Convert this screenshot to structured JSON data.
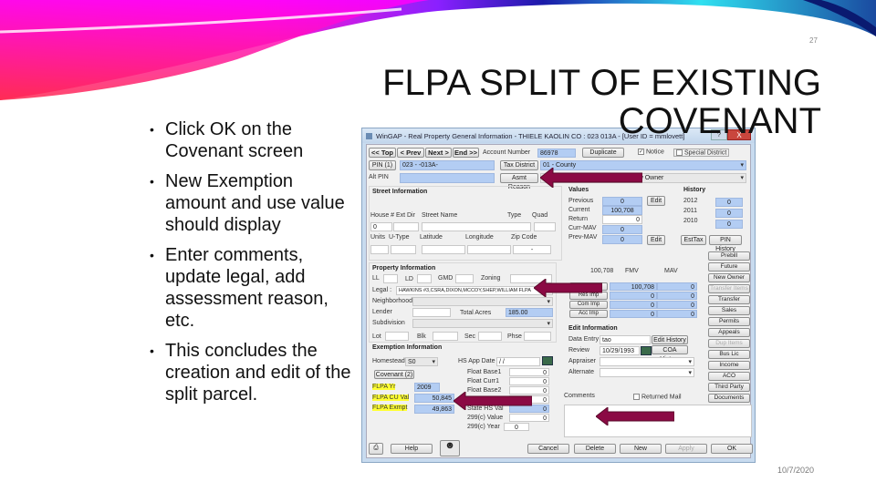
{
  "slide": {
    "number": "27",
    "title": "FLPA SPLIT OF EXISTING COVENANT",
    "date": "10/7/2020",
    "bullets": [
      "Click OK on the Covenant screen",
      "New Exemption amount and use value should display",
      "Enter comments, update legal, add assessment reason, etc.",
      "This concludes the creation and edit of the split parcel."
    ]
  },
  "window": {
    "title": "WinGAP - Real Property General Information - THIELE KAOLIN CO : 023    013A      - [User ID = mmlovett]",
    "help_btn": "?",
    "close_btn": "X",
    "nav": {
      "top": "<< Top",
      "prev": "< Prev",
      "next": "Next >",
      "end": "End >>"
    },
    "account_number_label": "Account Number",
    "account_number": "86978",
    "duplicate": "Duplicate",
    "notice_label": "Notice",
    "notice_checked": true,
    "special_district_label": "Special District",
    "pin_btn": "PIN (1)",
    "pin_value": "023 -  -013A-",
    "tax_district_btn": "Tax District",
    "tax_district_value": "01 - County",
    "alt_pin_label": "Alt PIN",
    "asmt_reason_btn": "Asmt Reason",
    "asmt_reason_value": "to New Owner",
    "street": {
      "heading": "Street Information",
      "labels": [
        "House #",
        "Ext",
        "Dir",
        "Street Name",
        "Type",
        "Quad"
      ],
      "house_no": "0",
      "labels2": [
        "Units",
        "U-Type",
        "Latitude",
        "Longitude",
        "Zip Code"
      ],
      "zip": "-"
    },
    "values": {
      "heading": "Values",
      "previous_label": "Previous",
      "previous": "0",
      "current_label": "Current",
      "current": "100,708",
      "return_label": "Return",
      "return": "0",
      "curr_mav_label": "Curr-MAV",
      "curr_mav": "0",
      "prev_mav_label": "Prev-MAV",
      "prev_mav": "0",
      "edit": "Edit"
    },
    "history": {
      "heading": "History",
      "rows": [
        {
          "year": "2012",
          "value": "0"
        },
        {
          "year": "2011",
          "value": "0"
        },
        {
          "year": "2010",
          "value": "0"
        }
      ],
      "est_tax": "EstTax",
      "pin_history": "PIN History"
    },
    "property": {
      "heading": "Property Information",
      "ll": "LL",
      "ld": "LD",
      "gmd": "GMD",
      "zoning": "Zoning",
      "legal_label": "Legal :",
      "legal": "HAWKINS #3,CSRA,DIXON,MCCOY,SHEP,WILLIAM FLPA",
      "neighborhood": "Neighborhood",
      "lender": "Lender",
      "total_acres_label": "Total Acres",
      "total_acres": "185.00",
      "subdivision": "Subdivision",
      "lot": "Lot",
      "blk": "Blk",
      "sec": "Sec",
      "phse": "Phse"
    },
    "improvements": {
      "total": "100,708",
      "fmv_label": "FMV",
      "mav_label": "MAV",
      "rows": [
        {
          "label": "Land",
          "fmv": "100,708",
          "mav": "0"
        },
        {
          "label": "Res Imp",
          "fmv": "0",
          "mav": "0"
        },
        {
          "label": "Com Imp",
          "fmv": "0",
          "mav": "0"
        },
        {
          "label": "Acc Imp",
          "fmv": "0",
          "mav": "0"
        }
      ]
    },
    "side_buttons": [
      {
        "label": "Prebill",
        "disabled": false
      },
      {
        "label": "Future",
        "disabled": false
      },
      {
        "label": "New Owner",
        "disabled": false
      },
      {
        "label": "Transfer Items",
        "disabled": true
      },
      {
        "label": "Transfer",
        "disabled": false
      },
      {
        "label": "Sales",
        "disabled": false
      },
      {
        "label": "Permits",
        "disabled": false
      },
      {
        "label": "Appeals",
        "disabled": false
      },
      {
        "label": "Dup Items",
        "disabled": true
      },
      {
        "label": "Bus Lic",
        "disabled": false
      },
      {
        "label": "Income",
        "disabled": false
      },
      {
        "label": "ACO",
        "disabled": false
      },
      {
        "label": "Third Party",
        "disabled": false
      },
      {
        "label": "Documents",
        "disabled": false
      }
    ],
    "edit_info": {
      "heading": "Edit Information",
      "data_entry_label": "Data Entry",
      "data_entry": "tao",
      "review_label": "Review",
      "review": "10/29/1993",
      "appraiser_label": "Appraiser",
      "alternate_label": "Alternate",
      "edit_history": "Edit History",
      "coa_history": "COA History"
    },
    "comments_label": "Comments",
    "returned_mail_label": "Returned Mail",
    "exemption": {
      "heading": "Exemption Information",
      "homestead_label": "Homestead",
      "homestead": "S0",
      "covenant_btn": "Covenant (2)",
      "flpa_yr_label": "FLPA Yr",
      "flpa_yr": "2009",
      "flpa_cu_label": "FLPA CU Val",
      "flpa_cu": "50,845",
      "flpa_exmpt_label": "FLPA Exmpt",
      "flpa_exmpt": "49,863",
      "hs_app_date_label": "HS App Date",
      "hs_app_date": " / /",
      "right_rows": [
        {
          "label": "Float Base1",
          "value": "0"
        },
        {
          "label": "Float Curr1",
          "value": "0"
        },
        {
          "label": "Float Base2",
          "value": "0"
        },
        {
          "label": "Float Curr2",
          "value": "0"
        },
        {
          "label": "State HS Val",
          "value": "0"
        },
        {
          "label": "299(c) Value",
          "value": "0"
        },
        {
          "label": "299(c) Year",
          "value": "0"
        }
      ]
    },
    "footer": {
      "help": "Help",
      "cancel": "Cancel",
      "delete": "Delete",
      "new": "New",
      "apply": "Apply",
      "ok": "OK"
    }
  },
  "colors": {
    "arrow": "#8b0a44",
    "field_blue": "#b3cdf3",
    "highlight": "#ffff33"
  }
}
